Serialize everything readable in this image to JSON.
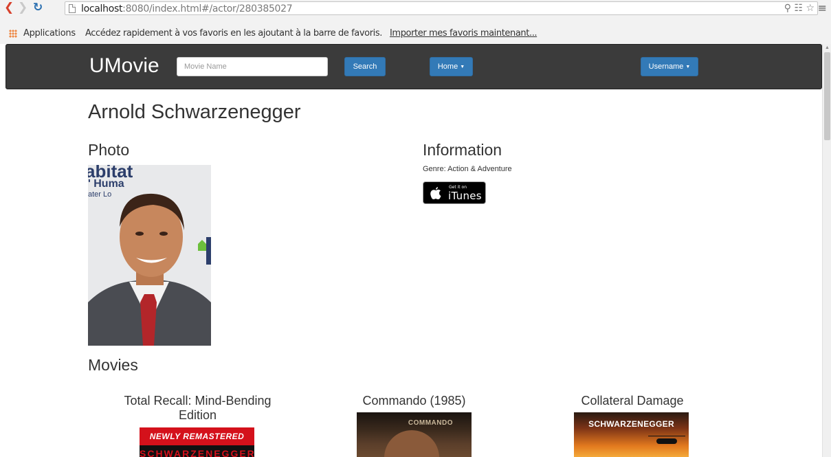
{
  "browser": {
    "url_host": "localhost",
    "url_rest": ":8080/index.html#/actor/280385027",
    "bookmarks": {
      "apps_label": "Applications",
      "hint_text": "Accédez rapidement à vos favoris en les ajoutant à la barre de favoris.",
      "import_link": "Importer mes favoris maintenant..."
    }
  },
  "navbar": {
    "brand": "UMovie",
    "search_placeholder": "Movie Name",
    "search_button": "Search",
    "home_button": "Home",
    "user_button": "Username"
  },
  "actor": {
    "name": "Arnold Schwarzenegger",
    "photo_heading": "Photo",
    "info_heading": "Information",
    "genre": "Genre: Action & Adventure",
    "itunes": {
      "small": "Get it on",
      "big": "iTunes"
    }
  },
  "movies": {
    "heading": "Movies",
    "items": [
      {
        "title": "Total Recall: Mind-Bending Edition",
        "poster_band": "NEWLY REMASTERED",
        "poster_name": "SCHWARZENEGGER"
      },
      {
        "title": "Commando (1985)",
        "poster_name": "COMMANDO"
      },
      {
        "title": "Collateral Damage",
        "poster_name": "SCHWARZENEGGER"
      }
    ]
  },
  "colors": {
    "navbar_bg": "#3b3b3b",
    "button_blue": "#337ab7"
  }
}
